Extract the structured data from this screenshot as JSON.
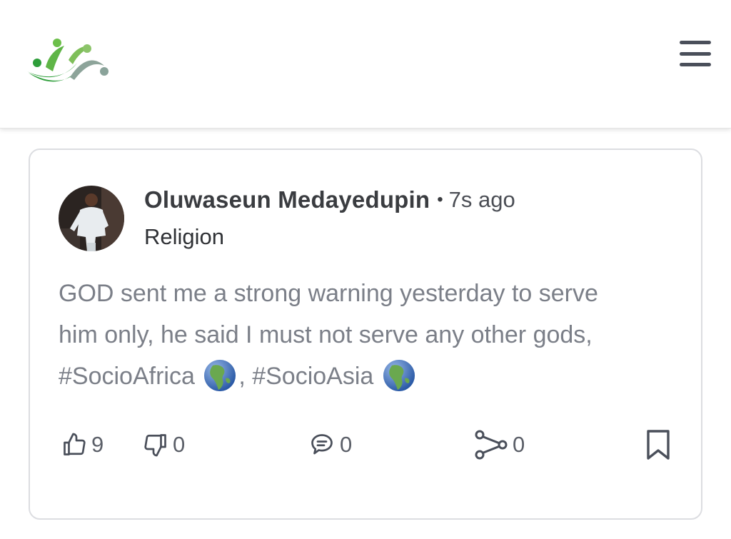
{
  "header": {
    "logo_icon": "community-people-logo",
    "menu_icon": "hamburger-menu-icon",
    "brand_colors": [
      "#2e9e3a",
      "#6cbf4a",
      "#8aa39a"
    ]
  },
  "post": {
    "author": "Oluwaseun Medayedupin",
    "separator": "•",
    "time_ago": "7s ago",
    "category": "Religion",
    "text_part1": "GOD sent me a strong warning yesterday to serve him only, he said I must not serve any other gods, #SocioAfrica ",
    "text_part2": ", #SocioAsia ",
    "emoji_icon": "globe-earth-icon",
    "actions": {
      "likes": "9",
      "dislikes": "0",
      "comments": "0",
      "shares": "0"
    }
  }
}
